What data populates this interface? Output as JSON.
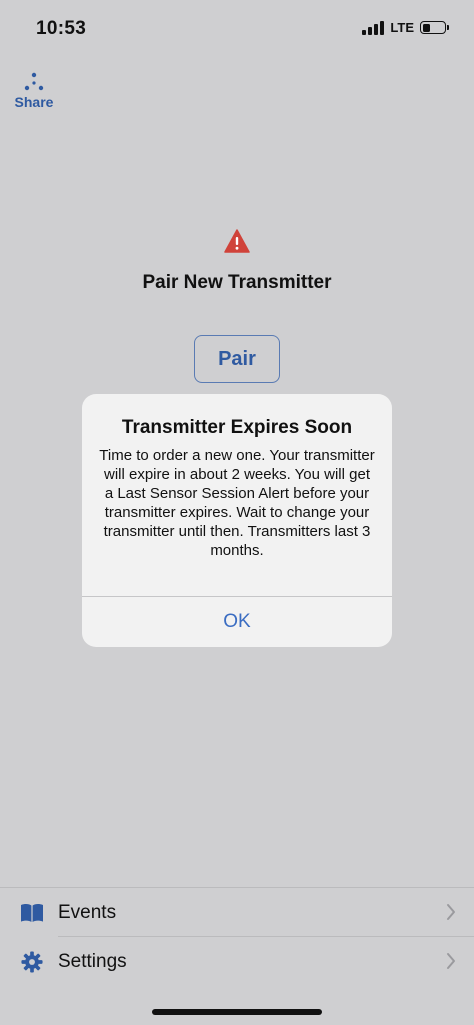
{
  "status_bar": {
    "time": "10:53",
    "network": "LTE"
  },
  "share": {
    "label": "Share",
    "icon": "share-dots-icon"
  },
  "main": {
    "warning_icon": "warning-triangle-icon",
    "title": "Pair New Transmitter",
    "pair_button_label": "Pair"
  },
  "alert": {
    "title": "Transmitter Expires Soon",
    "message": "Time to order a new one. Your transmitter will expire in about 2 weeks. You will get a Last Sensor Session Alert before your transmitter expires. Wait to change your transmitter until then. Transmitters last 3 months.",
    "ok_label": "OK"
  },
  "bottom_menu": {
    "items": [
      {
        "label": "Events",
        "icon": "book-icon"
      },
      {
        "label": "Settings",
        "icon": "gear-icon"
      }
    ]
  },
  "colors": {
    "background": "#cfcfd1",
    "accent_blue": "#2f5aa1",
    "alert_button_blue": "#3b6dc2",
    "warning_red": "#d0433a"
  }
}
